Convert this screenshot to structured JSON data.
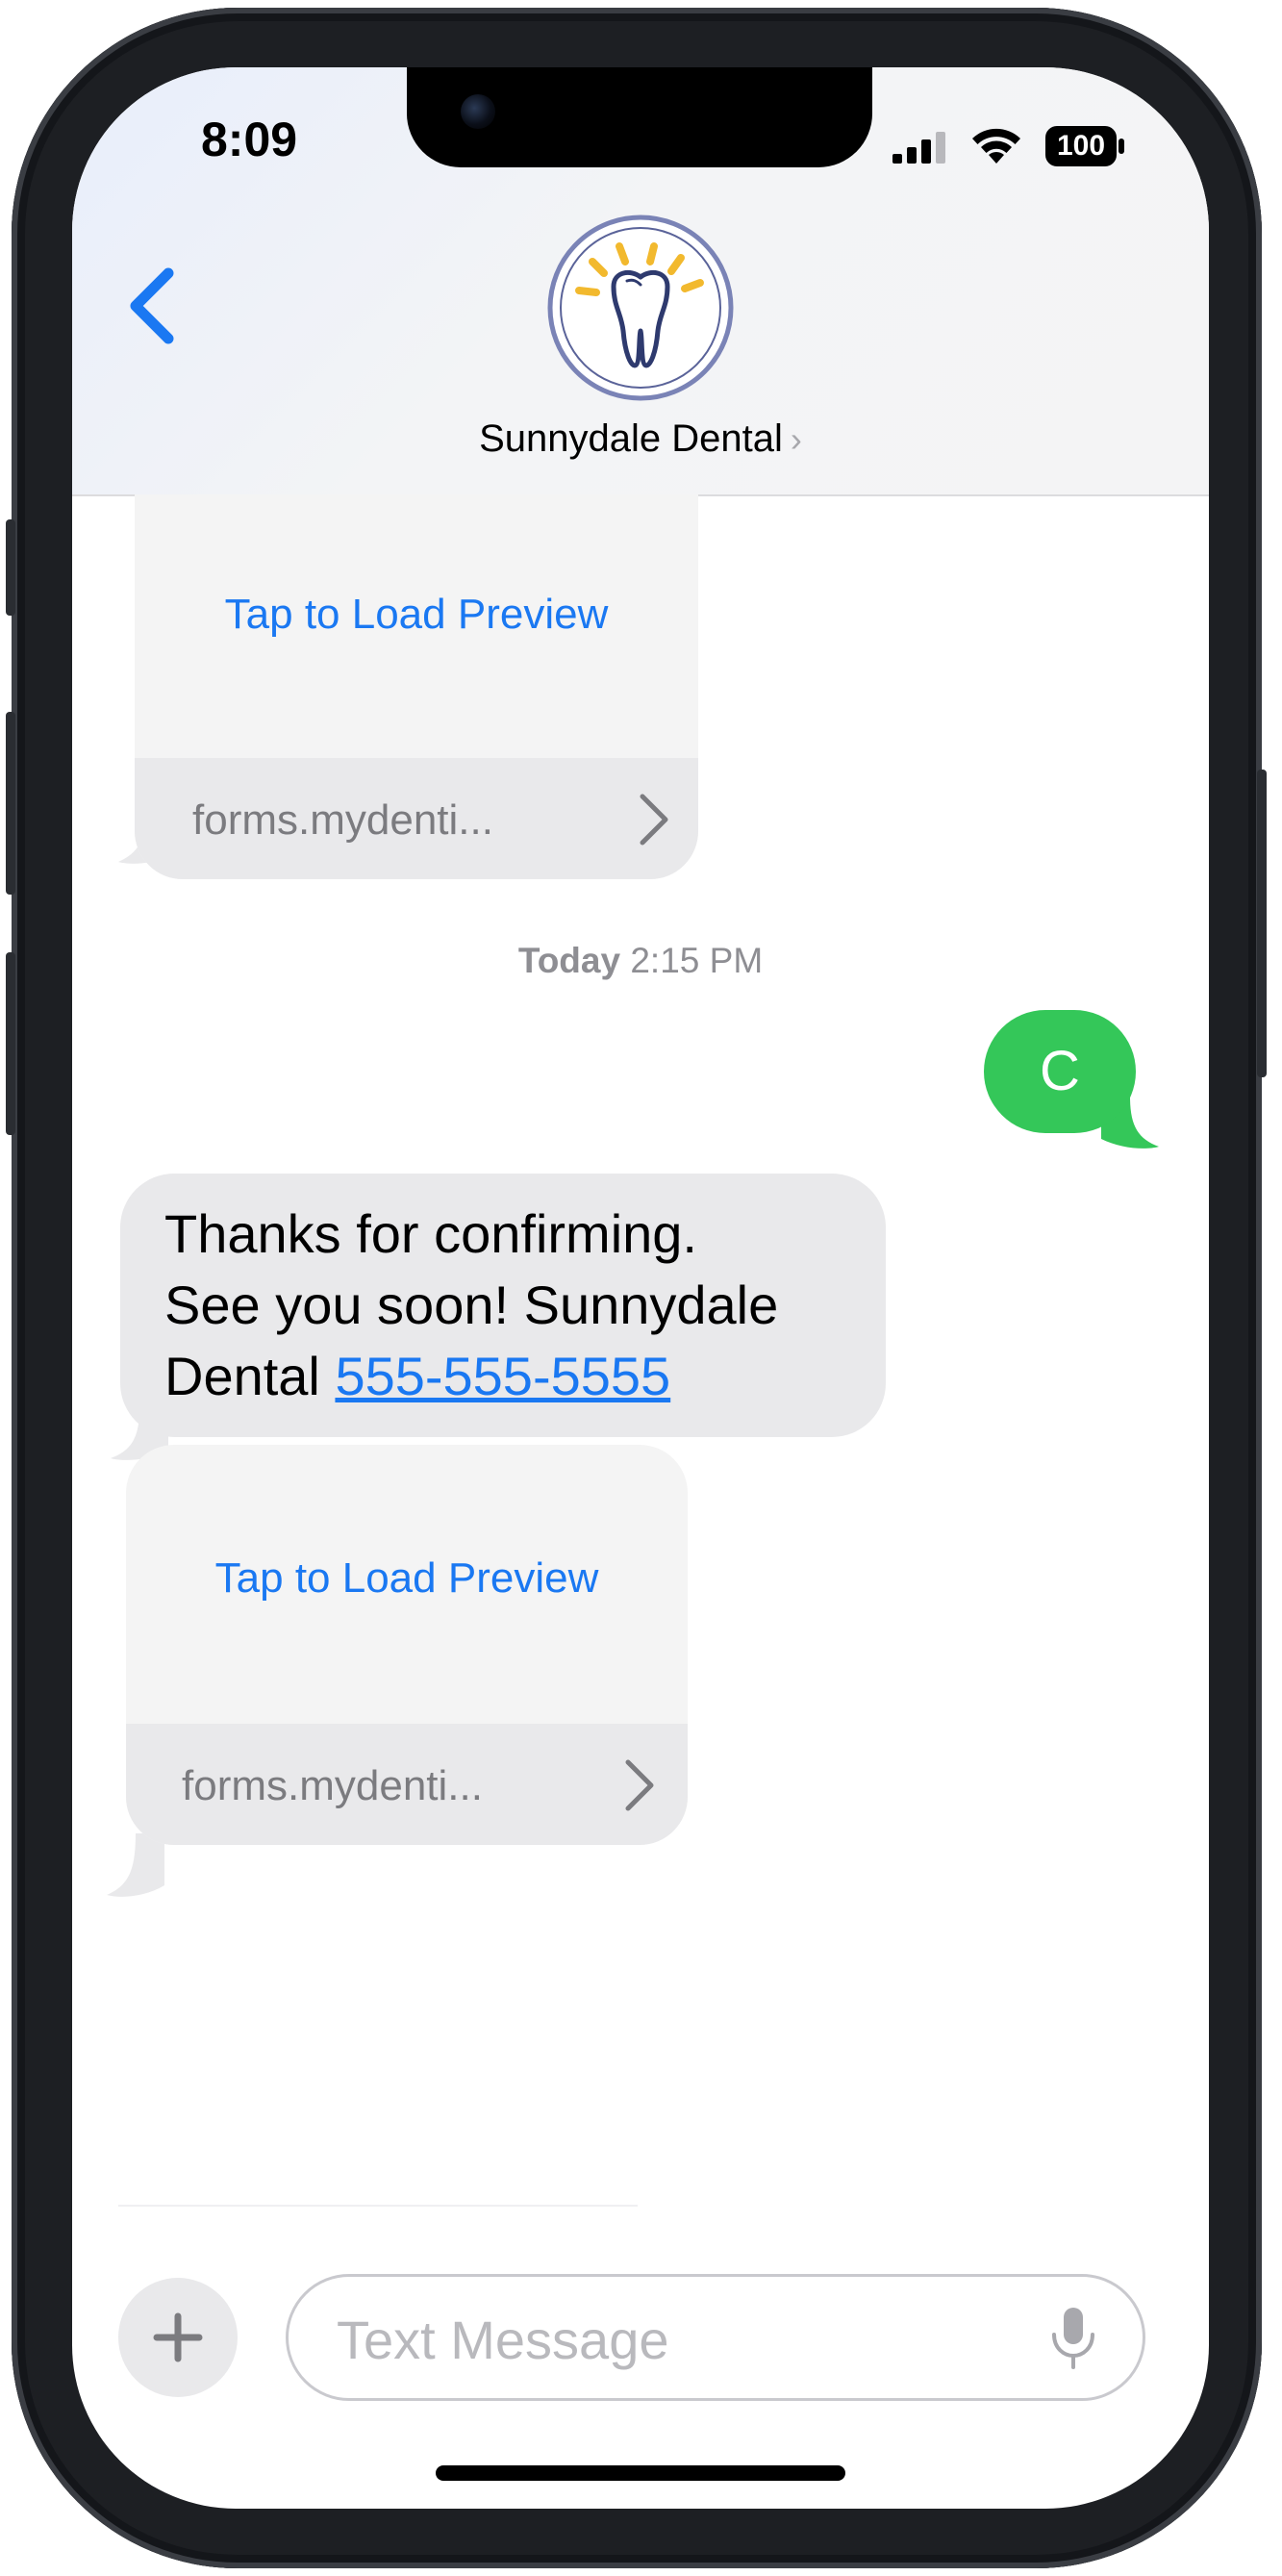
{
  "status_bar": {
    "time": "8:09",
    "battery": "100"
  },
  "header": {
    "contact_name": "Sunnydale Dental",
    "back_icon": "chevron-left-icon",
    "avatar_icon": "tooth-icon"
  },
  "messages": {
    "link_card_1": {
      "preview": "Tap to Load Preview",
      "domain": "forms.mydenti..."
    },
    "timestamp": {
      "day": "Today",
      "time": "2:15 PM"
    },
    "outgoing_1": {
      "text": "C"
    },
    "incoming_1": {
      "line1": "Thanks for confirming.",
      "line2": "See you soon! Sunnydale",
      "line3_prefix": "Dental ",
      "phone": "555-555-5555"
    },
    "link_card_2": {
      "preview": "Tap to Load Preview",
      "domain": "forms.mydenti..."
    }
  },
  "compose": {
    "placeholder": "Text Message",
    "plus_icon": "plus-icon",
    "mic_icon": "microphone-icon"
  },
  "colors": {
    "accent_blue": "#1a78f2",
    "imessage_green": "#34c759",
    "incoming_gray": "#e9e9eb"
  }
}
